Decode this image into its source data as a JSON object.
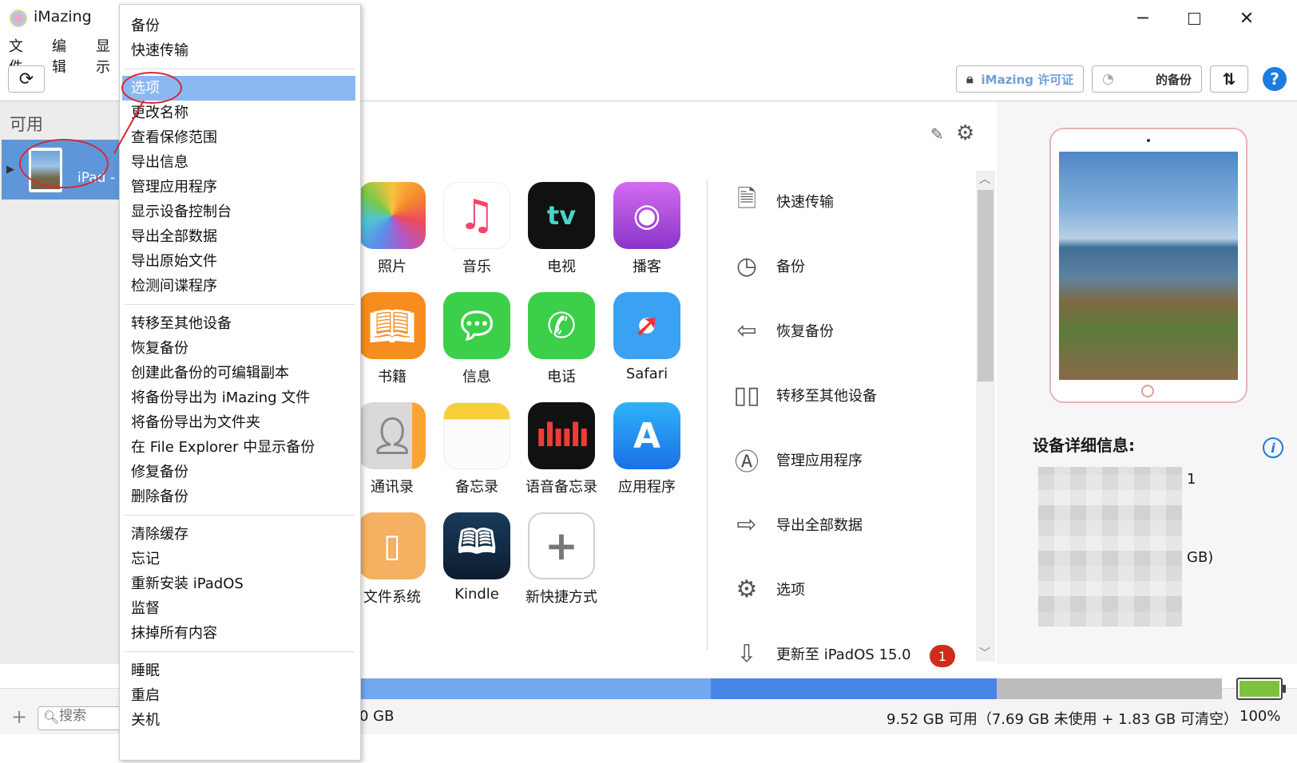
{
  "window": {
    "title": "iMazing"
  },
  "menubar": {
    "items": [
      "文件",
      "编辑",
      "显示"
    ]
  },
  "toolbar": {
    "license_label": "iMazing 许可证",
    "backup_label": "的备份",
    "help_label": "?"
  },
  "sidebar": {
    "heading": "可用",
    "device_name": "iPad -"
  },
  "search": {
    "placeholder": "搜索"
  },
  "apps": [
    {
      "label": "照片"
    },
    {
      "label": "音乐"
    },
    {
      "label": "电视"
    },
    {
      "label": "播客"
    },
    {
      "label": "书籍"
    },
    {
      "label": "信息"
    },
    {
      "label": "电话"
    },
    {
      "label": "Safari"
    },
    {
      "label": "通讯录"
    },
    {
      "label": "备忘录"
    },
    {
      "label": "语音备忘录"
    },
    {
      "label": "应用程序"
    },
    {
      "label": "文件系统"
    },
    {
      "label": "Kindle"
    },
    {
      "label": "新快捷方式"
    }
  ],
  "actions": [
    {
      "label": "快速传输"
    },
    {
      "label": "备份"
    },
    {
      "label": "恢复备份"
    },
    {
      "label": "转移至其他设备"
    },
    {
      "label": "管理应用程序"
    },
    {
      "label": "导出全部数据"
    },
    {
      "label": "选项"
    },
    {
      "label": "更新至 iPadOS 15.0"
    }
  ],
  "update_badge": "1",
  "details": {
    "heading": "设备详细信息:",
    "frag1": "1",
    "frag2": "GB)"
  },
  "storage": {
    "left_text": "0 GB",
    "text": "9.52 GB 可用（7.69 GB 未使用 + 1.83 GB 可清空）",
    "battery_percent": "100%",
    "used_fraction": 0.41,
    "other_fraction": 0.33
  },
  "context_menu": {
    "items": [
      "备份",
      "快速传输",
      "选项",
      "更改名称",
      "查看保修范围",
      "导出信息",
      "管理应用程序",
      "显示设备控制台",
      "导出全部数据",
      "导出原始文件",
      "检测间谍程序",
      "转移至其他设备",
      "恢复备份",
      "创建此备份的可编辑副本",
      "将备份导出为 iMazing 文件",
      "将备份导出为文件夹",
      "在 File Explorer 中显示备份",
      "修复备份",
      "删除备份",
      "清除缓存",
      "忘记",
      "重新安装 iPadOS",
      "监督",
      "抹掉所有内容",
      "睡眠",
      "重启",
      "关机"
    ],
    "highlighted": "选项"
  },
  "colors": {
    "accent": "#1c7be0",
    "highlight": "#8ab8f2",
    "annotation": "#d8282c",
    "storage_used": "#71a8f0",
    "storage_other": "#4785e4",
    "battery": "#7cc240"
  }
}
